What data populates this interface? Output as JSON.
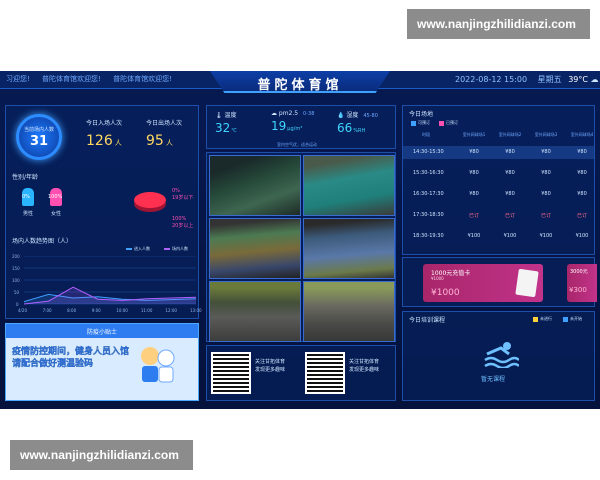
{
  "watermark": {
    "top": "www.nanjingzhilidianzi.com",
    "bottom": "www.nanjingzhilidianzi.com"
  },
  "header": {
    "ticker": [
      "习迎您!",
      "普陀体育馆欢迎您!",
      "普陀体育馆欢迎您!"
    ],
    "title": "普陀体育馆",
    "date": "2022-08-12 15:00",
    "weekday": "星期五",
    "temperature": "39°C"
  },
  "left": {
    "ring_label": "当前场内人数",
    "ring_value": "31",
    "today_in_label": "今日入场人次",
    "today_in_value": "126",
    "today_out_label": "今日出场人次",
    "today_out_value": "95",
    "unit": "人",
    "gender_title": "性别/年龄",
    "gender": [
      {
        "label": "男性",
        "pct": "0%"
      },
      {
        "label": "女性",
        "pct": "100%"
      }
    ],
    "age_pct": [
      {
        "label": "0%",
        "sub": "19岁以下"
      },
      {
        "label": "100%",
        "sub": "20岁以上"
      }
    ],
    "trend_title": "场内人数趋势图（人）",
    "trend_legend": [
      "进入人数",
      "场内人数"
    ],
    "trend_y": [
      "200",
      "150",
      "100",
      "50",
      "0"
    ],
    "trend_x": [
      "4/20",
      "7:00",
      "8:00",
      "9:00",
      "10:00",
      "11:00",
      "12:00",
      "13:00"
    ]
  },
  "chart_data": {
    "type": "area",
    "title": "场内人数趋势图（人）",
    "ylim": [
      0,
      200
    ],
    "x": [
      "4/20",
      "7:00",
      "8:00",
      "9:00",
      "10:00",
      "11:00",
      "12:00",
      "13:00"
    ],
    "series": [
      {
        "name": "进入人数",
        "values": [
          10,
          40,
          25,
          30,
          20,
          15,
          18,
          22
        ]
      },
      {
        "name": "场内人数",
        "values": [
          0,
          12,
          70,
          20,
          15,
          22,
          25,
          28
        ]
      }
    ]
  },
  "env": {
    "temp_label": "温度",
    "temp_value": "32",
    "temp_unit": "℃",
    "pm_label": "pm2.5",
    "pm_range": "0-38",
    "pm_value": "19",
    "pm_unit": "μg/m³",
    "hum_label": "湿度",
    "hum_range": "45-80",
    "hum_value": "66",
    "hum_unit": "%RH",
    "note": "室内空气优，适合运动"
  },
  "qr": [
    {
      "text1": "关注甘拓体育",
      "text2": "发现更多趣味"
    },
    {
      "text1": "关注甘拓体育",
      "text2": "发现更多趣味"
    }
  ],
  "schedule": {
    "title": "今日场地",
    "legend": [
      "可预订",
      "已预订"
    ],
    "columns": [
      "时段",
      "室外网球场1",
      "室外网球场2",
      "室外网球场3",
      "室外网球场4"
    ],
    "rows": [
      {
        "time": "14:30-15:30",
        "cells": [
          "¥80",
          "¥80",
          "¥80",
          "¥80"
        ],
        "hi": true,
        "red": [
          false,
          false,
          false,
          false
        ]
      },
      {
        "time": "15:30-16:30",
        "cells": [
          "¥80",
          "¥80",
          "¥80",
          "¥80"
        ],
        "hi": false,
        "red": [
          false,
          false,
          false,
          false
        ]
      },
      {
        "time": "16:30-17:30",
        "cells": [
          "¥80",
          "¥80",
          "¥80",
          "¥80"
        ],
        "hi": false,
        "red": [
          false,
          false,
          false,
          false
        ]
      },
      {
        "time": "17:30-18:30",
        "cells": [
          "已订",
          "已订",
          "已订",
          "已订"
        ],
        "hi": false,
        "red": [
          true,
          true,
          true,
          true
        ]
      },
      {
        "time": "18:30-19:30",
        "cells": [
          "¥100",
          "¥100",
          "¥100",
          "¥100"
        ],
        "hi": false,
        "red": [
          false,
          false,
          false,
          false
        ]
      }
    ]
  },
  "cards": [
    {
      "title": "1000元充值卡",
      "sub": "¥1000",
      "price": "¥1000"
    },
    {
      "title": "3000元",
      "sub": "",
      "price": "¥300"
    }
  ],
  "training": {
    "title": "今日培训课程",
    "legend": [
      "未进行",
      "未开始"
    ],
    "empty": "暂无课程"
  },
  "notice": {
    "title": "防疫小贴士",
    "body": "疫情防控期间，健身人员入馆请配合做好测温验码"
  },
  "colors": {
    "accent": "#3fa0ff",
    "gold": "#ffd860",
    "pink": "#c2338a"
  }
}
